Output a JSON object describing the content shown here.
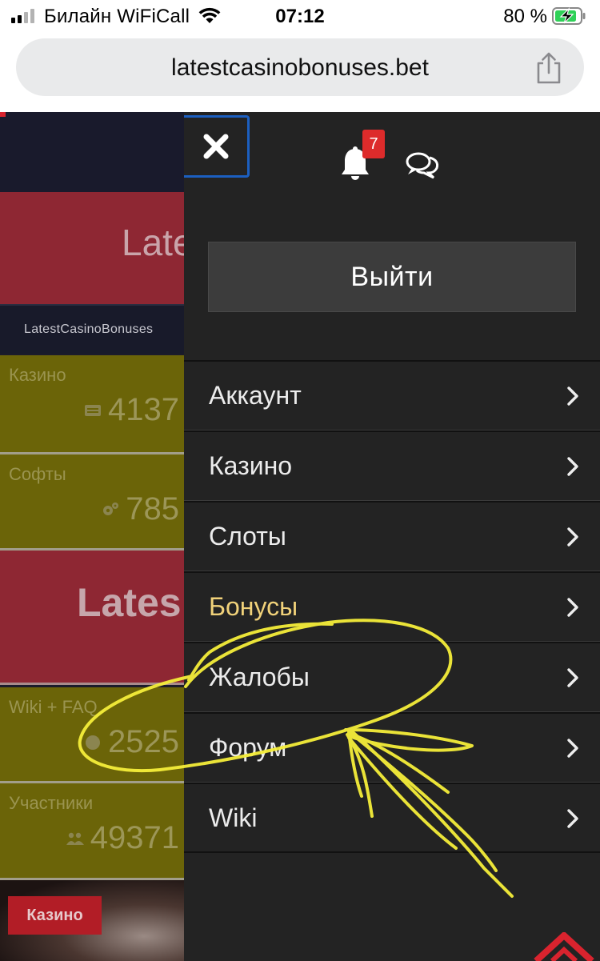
{
  "status_bar": {
    "carrier": "Билайн WiFiCall",
    "time": "07:12",
    "battery": "80 %"
  },
  "browser": {
    "url": "latestcasinobonuses.bet"
  },
  "background_page": {
    "hero_title": "Lates",
    "site_tab": "LatestCasinoBonuses",
    "stats": [
      {
        "label": "Казино",
        "value": "4137",
        "icon": "list-icon"
      },
      {
        "label": "Софты",
        "value": "785",
        "icon": "gears-icon"
      },
      {
        "label": "Wiki + FAQ",
        "value": "2525",
        "icon": "question-icon"
      },
      {
        "label": "Участники",
        "value": "49371",
        "icon": "users-icon"
      }
    ],
    "hero2_title": "Lates",
    "casino_badge": "Казино"
  },
  "drawer": {
    "notifications_count": "7",
    "logout_label": "Выйти",
    "menu": [
      {
        "label": "Аккаунт"
      },
      {
        "label": "Казино"
      },
      {
        "label": "Слоты"
      },
      {
        "label": "Бонусы"
      },
      {
        "label": "Жалобы"
      },
      {
        "label": "Форум"
      },
      {
        "label": "Wiki"
      }
    ]
  },
  "colors": {
    "drawer_bg": "#232323",
    "active_menu": "#f1d27a",
    "badge": "#dd2b2b",
    "focus_ring": "#1c5fc0",
    "annotation": "#f5ee3a"
  }
}
